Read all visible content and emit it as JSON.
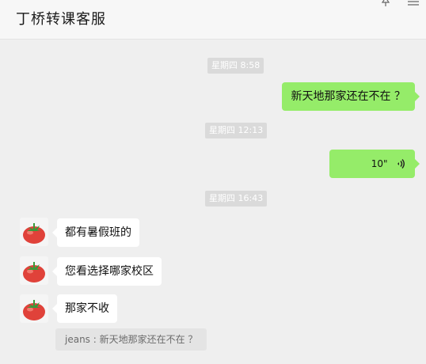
{
  "header": {
    "title": "丁桥转课客服",
    "pin_icon": "pin-icon",
    "more_icon": "more-icon"
  },
  "messages": [
    {
      "type": "time",
      "text": "星期四 8:58"
    },
    {
      "type": "outgoing",
      "text": "新天地那家还在不在 ？"
    },
    {
      "type": "time",
      "text": "星期四 12:13"
    },
    {
      "type": "outgoing-voice",
      "duration": "10\"",
      "icon": "voice-wave-icon"
    },
    {
      "type": "time",
      "text": "星期四 16:43"
    },
    {
      "type": "incoming",
      "text": "都有暑假班的",
      "avatar": "tomato-avatar"
    },
    {
      "type": "incoming",
      "text": "您看选择哪家校区",
      "avatar": "tomato-avatar"
    },
    {
      "type": "incoming",
      "text": "那家不收",
      "avatar": "tomato-avatar"
    }
  ],
  "quote": {
    "text": "jeans : 新天地那家还在不在 ？"
  },
  "colors": {
    "outgoing_bubble": "#95ec69",
    "incoming_bubble": "#ffffff",
    "background": "#efefef",
    "time_badge": "#dadada"
  }
}
